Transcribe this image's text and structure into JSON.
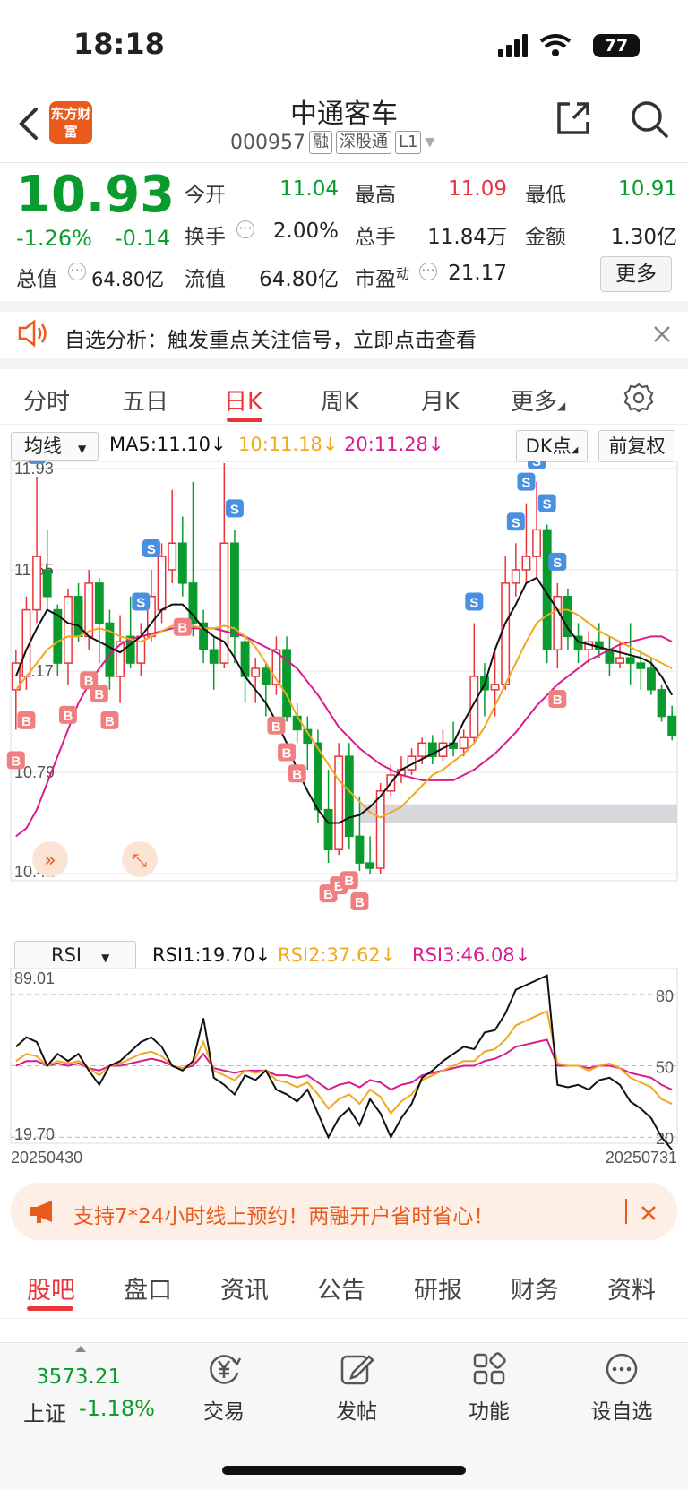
{
  "status": {
    "time": "18:18",
    "battery": "77"
  },
  "header": {
    "logo_text": "东方财富",
    "title": "中通客车",
    "code": "000957",
    "tags": [
      "融",
      "深股通",
      "L1"
    ]
  },
  "quote": {
    "price": "10.93",
    "change_pct": "-1.26%",
    "change": "-0.14",
    "fields": [
      {
        "label": "今开",
        "value": "11.04",
        "color": "green"
      },
      {
        "label": "最高",
        "value": "11.09",
        "color": "red"
      },
      {
        "label": "最低",
        "value": "10.91",
        "color": "green"
      },
      {
        "label": "换手",
        "value": "2.00%",
        "color": "black"
      },
      {
        "label": "总手",
        "value": "11.84万",
        "color": "black"
      },
      {
        "label": "金额",
        "value": "1.30亿",
        "color": "black"
      },
      {
        "label": "总值",
        "value": "64.80亿",
        "color": "black"
      },
      {
        "label": "流值",
        "value": "64.80亿",
        "color": "black"
      },
      {
        "label": "市盈",
        "label_sup": "动",
        "value": "21.17",
        "color": "black"
      }
    ],
    "more_label": "更多"
  },
  "notice": {
    "text": "自选分析：触发重点关注信号，立即点击查看"
  },
  "period_tabs": [
    "分时",
    "五日",
    "日K",
    "周K",
    "月K",
    "更多"
  ],
  "active_tab": "日K",
  "ma": {
    "selector": "均线",
    "ma5": "MA5:11.10",
    "ma10": "10:11.18",
    "ma20": "20:11.28",
    "dk_label": "DK点",
    "adjust_label": "前复权",
    "colors": {
      "ma5": "#111111",
      "ma10": "#f0a81f",
      "ma20": "#d81b8f"
    }
  },
  "kline": {
    "y_labels": [
      "11.93",
      "11.55",
      "11.17",
      "10.79",
      "10.41"
    ],
    "ylim": [
      10.41,
      11.93
    ],
    "candles": [
      [
        11.1,
        11.2,
        10.95,
        11.25
      ],
      [
        11.15,
        11.4,
        11.1,
        11.45
      ],
      [
        11.4,
        11.6,
        11.35,
        11.9
      ],
      [
        11.55,
        11.45,
        11.4,
        11.7
      ],
      [
        11.4,
        11.2,
        11.15,
        11.42
      ],
      [
        11.2,
        11.45,
        11.12,
        11.48
      ],
      [
        11.45,
        11.3,
        11.28,
        11.5
      ],
      [
        11.3,
        11.5,
        11.25,
        11.55
      ],
      [
        11.5,
        11.35,
        11.2,
        11.52
      ],
      [
        11.35,
        11.15,
        11.1,
        11.4
      ],
      [
        11.15,
        11.28,
        11.05,
        11.38
      ],
      [
        11.3,
        11.2,
        11.18,
        11.45
      ],
      [
        11.2,
        11.3,
        11.15,
        11.35
      ],
      [
        11.3,
        11.45,
        11.28,
        11.55
      ],
      [
        11.4,
        11.6,
        11.35,
        11.65
      ],
      [
        11.55,
        11.65,
        11.5,
        11.85
      ],
      [
        11.65,
        11.5,
        11.45,
        11.75
      ],
      [
        11.5,
        11.35,
        11.3,
        11.88
      ],
      [
        11.35,
        11.25,
        11.2,
        11.4
      ],
      [
        11.25,
        11.2,
        11.1,
        11.3
      ],
      [
        11.2,
        11.65,
        11.18,
        11.95
      ],
      [
        11.65,
        11.3,
        11.2,
        11.7
      ],
      [
        11.28,
        11.15,
        11.05,
        11.3
      ],
      [
        11.15,
        11.18,
        11.05,
        11.22
      ],
      [
        11.18,
        11.12,
        11.0,
        11.2
      ],
      [
        11.12,
        11.25,
        11.08,
        11.3
      ],
      [
        11.25,
        11.0,
        10.98,
        11.3
      ],
      [
        11.0,
        10.95,
        10.9,
        11.05
      ],
      [
        10.95,
        10.9,
        10.8,
        11.0
      ],
      [
        10.9,
        10.65,
        10.6,
        10.95
      ],
      [
        10.65,
        10.5,
        10.45,
        10.8
      ],
      [
        10.5,
        10.85,
        10.48,
        10.9
      ],
      [
        10.85,
        10.55,
        10.5,
        10.9
      ],
      [
        10.55,
        10.45,
        10.42,
        10.7
      ],
      [
        10.45,
        10.43,
        10.41,
        10.55
      ],
      [
        10.43,
        10.72,
        10.41,
        10.75
      ],
      [
        10.72,
        10.78,
        10.7,
        10.82
      ],
      [
        10.78,
        10.8,
        10.75,
        10.85
      ],
      [
        10.8,
        10.85,
        10.78,
        10.88
      ],
      [
        10.85,
        10.9,
        10.82,
        10.92
      ],
      [
        10.9,
        10.85,
        10.82,
        10.93
      ],
      [
        10.85,
        10.9,
        10.83,
        10.95
      ],
      [
        10.9,
        10.88,
        10.85,
        10.98
      ],
      [
        10.88,
        10.92,
        10.85,
        10.95
      ],
      [
        10.92,
        11.15,
        10.9,
        11.35
      ],
      [
        11.15,
        11.1,
        11.0,
        11.2
      ],
      [
        11.1,
        11.12,
        11.0,
        11.25
      ],
      [
        11.12,
        11.5,
        11.1,
        11.6
      ],
      [
        11.5,
        11.55,
        11.45,
        11.65
      ],
      [
        11.55,
        11.6,
        11.5,
        11.8
      ],
      [
        11.6,
        11.7,
        11.52,
        11.88
      ],
      [
        11.7,
        11.25,
        11.2,
        11.72
      ],
      [
        11.25,
        11.45,
        11.18,
        11.5
      ],
      [
        11.45,
        11.3,
        11.25,
        11.48
      ],
      [
        11.3,
        11.25,
        11.2,
        11.35
      ],
      [
        11.25,
        11.28,
        11.2,
        11.32
      ],
      [
        11.28,
        11.25,
        11.22,
        11.35
      ],
      [
        11.25,
        11.2,
        11.15,
        11.3
      ],
      [
        11.2,
        11.22,
        11.18,
        11.28
      ],
      [
        11.22,
        11.2,
        11.12,
        11.35
      ],
      [
        11.2,
        11.18,
        11.1,
        11.25
      ],
      [
        11.18,
        11.1,
        11.08,
        11.22
      ],
      [
        11.1,
        11.0,
        10.98,
        11.12
      ],
      [
        11.0,
        10.93,
        10.91,
        11.04
      ]
    ],
    "ma5": [
      11.15,
      11.25,
      11.33,
      11.4,
      11.38,
      11.35,
      11.34,
      11.3,
      11.28,
      11.26,
      11.24,
      11.27,
      11.3,
      11.35,
      11.4,
      11.42,
      11.42,
      11.38,
      11.33,
      11.3,
      11.28,
      11.22,
      11.15,
      11.1,
      11.05,
      10.98,
      10.9,
      10.8,
      10.72,
      10.65,
      10.6,
      10.6,
      10.62,
      10.63,
      10.66,
      10.7,
      10.75,
      10.8,
      10.82,
      10.84,
      10.86,
      10.88,
      10.9,
      10.98,
      11.05,
      11.12,
      11.25,
      11.35,
      11.42,
      11.5,
      11.52,
      11.46,
      11.4,
      11.33,
      11.28,
      11.27,
      11.26,
      11.25,
      11.24,
      11.23,
      11.22,
      11.2,
      11.15,
      11.08
    ],
    "ma10": [
      11.1,
      11.15,
      11.2,
      11.25,
      11.28,
      11.3,
      11.3,
      11.32,
      11.33,
      11.32,
      11.3,
      11.29,
      11.28,
      11.3,
      11.32,
      11.34,
      11.34,
      11.34,
      11.33,
      11.33,
      11.34,
      11.33,
      11.3,
      11.26,
      11.2,
      11.14,
      11.08,
      11.0,
      10.94,
      10.88,
      10.82,
      10.76,
      10.72,
      10.68,
      10.64,
      10.62,
      10.64,
      10.66,
      10.7,
      10.74,
      10.78,
      10.8,
      10.83,
      10.86,
      10.9,
      10.96,
      11.04,
      11.12,
      11.2,
      11.28,
      11.35,
      11.38,
      11.4,
      11.4,
      11.38,
      11.35,
      11.32,
      11.3,
      11.28,
      11.26,
      11.24,
      11.22,
      11.2,
      11.18
    ],
    "ma20": [
      10.55,
      10.58,
      10.65,
      10.75,
      10.85,
      10.95,
      11.05,
      11.12,
      11.18,
      11.23,
      11.27,
      11.29,
      11.3,
      11.31,
      11.32,
      11.33,
      11.33,
      11.33,
      11.33,
      11.33,
      11.32,
      11.31,
      11.3,
      11.28,
      11.26,
      11.24,
      11.21,
      11.18,
      11.13,
      11.08,
      11.02,
      10.96,
      10.92,
      10.88,
      10.85,
      10.82,
      10.8,
      10.78,
      10.77,
      10.76,
      10.76,
      10.76,
      10.76,
      10.78,
      10.8,
      10.83,
      10.86,
      10.9,
      10.94,
      10.99,
      11.04,
      11.08,
      11.12,
      11.15,
      11.18,
      11.21,
      11.23,
      11.25,
      11.27,
      11.28,
      11.29,
      11.3,
      11.3,
      11.28
    ],
    "range_band": [
      10.6,
      10.67
    ],
    "markers_s": [
      2,
      12,
      13,
      20,
      21,
      44,
      48,
      49,
      50,
      51,
      52
    ],
    "markers_b": [
      0,
      1,
      5,
      7,
      8,
      9,
      16,
      25,
      26,
      27,
      30,
      31,
      32,
      33,
      52
    ]
  },
  "rsi": {
    "selector": "RSI",
    "rsi1": "RSI1:19.70",
    "rsi2": "RSI2:37.62",
    "rsi3": "RSI3:46.08",
    "left_labels": [
      "89.01",
      "19.70"
    ],
    "right_labels": [
      "80",
      "50",
      "20"
    ],
    "ylim": [
      19.7,
      89.01
    ],
    "colors": {
      "rsi1": "#111111",
      "rsi2": "#f0a81f",
      "rsi3": "#d81b8f"
    },
    "rsi1_values": [
      58,
      62,
      60,
      50,
      55,
      52,
      55,
      48,
      42,
      50,
      52,
      56,
      60,
      62,
      58,
      50,
      48,
      52,
      70,
      45,
      42,
      38,
      46,
      44,
      48,
      40,
      38,
      35,
      40,
      30,
      20,
      28,
      32,
      25,
      36,
      30,
      20,
      28,
      34,
      45,
      48,
      52,
      55,
      58,
      57,
      64,
      65,
      72,
      82,
      84,
      86,
      88,
      42,
      41,
      42,
      40,
      44,
      45,
      42,
      35,
      32,
      28,
      20,
      14
    ],
    "rsi2_values": [
      52,
      55,
      54,
      50,
      52,
      51,
      52,
      49,
      46,
      50,
      51,
      53,
      55,
      56,
      54,
      50,
      49,
      51,
      60,
      48,
      46,
      44,
      48,
      47,
      48,
      44,
      43,
      41,
      43,
      38,
      32,
      36,
      38,
      34,
      40,
      37,
      30,
      35,
      38,
      44,
      46,
      48,
      50,
      52,
      52,
      56,
      57,
      61,
      67,
      69,
      71,
      73,
      51,
      50,
      50,
      48,
      50,
      51,
      49,
      45,
      43,
      41,
      36,
      34
    ],
    "rsi3_values": [
      50,
      52,
      52,
      50,
      51,
      50,
      51,
      49,
      48,
      50,
      50,
      51,
      52,
      53,
      52,
      50,
      49,
      50,
      55,
      49,
      48,
      47,
      48,
      48,
      48,
      46,
      46,
      45,
      46,
      43,
      40,
      42,
      43,
      41,
      44,
      43,
      40,
      42,
      43,
      46,
      47,
      48,
      49,
      50,
      50,
      52,
      53,
      55,
      58,
      59,
      60,
      61,
      50,
      50,
      50,
      49,
      50,
      50,
      49,
      47,
      46,
      45,
      42,
      40
    ],
    "date_start": "20250430",
    "date_end": "20250731"
  },
  "promo": {
    "text": "支持7*24小时线上预约！两融开户省时省心！"
  },
  "bottom_tabs": [
    "股吧",
    "盘口",
    "资讯",
    "公告",
    "研报",
    "财务",
    "资料"
  ],
  "active_bottom_tab": "股吧",
  "footer": {
    "index_value": "3573.21",
    "index_name": "上证",
    "index_change": "-1.18%",
    "items": [
      "交易",
      "发帖",
      "功能",
      "设自选"
    ]
  }
}
